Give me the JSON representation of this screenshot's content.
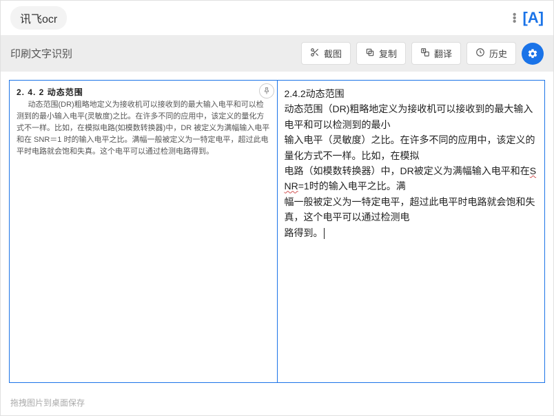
{
  "header": {
    "app_title": "讯飞ocr",
    "logo_text": "[A]"
  },
  "toolbar": {
    "page_title": "印刷文字识别",
    "screenshot_label": "截图",
    "copy_label": "复制",
    "translate_label": "翻译",
    "history_label": "历史"
  },
  "source": {
    "heading": "2. 4. 2  动态范围",
    "body": "动态范围(DR)粗略地定义为接收机可以接收到的最大输入电平和可以检测到的最小输入电平(灵敏度)之比。在许多不同的应用中，该定义的量化方式不一样。比如，在模拟电路(如模数转换器)中，DR 被定义为满幅输入电平和在 SNR＝1 时的输入电平之比。满幅一般被定义为一特定电平，超过此电平时电路就会饱和失真。这个电平可以通过检测电路得到。"
  },
  "result": {
    "line1": "2.4.2动态范围",
    "line2": "动态范围（DR)粗略地定义为接收机可以接收到的最大输入电平和可以检测到的最小",
    "line3": "输入电平（灵敏度）之比。在许多不同的应用中，该定义的量化方式不一样。比如，在模拟",
    "line4a": "电路（如模数转换器）中，DR被定义为满幅输入电平和在",
    "line4b_snr": "SNR",
    "line4c": "=1时的输入电平之比。满",
    "line5": "幅一般被定义为一特定电平，超过此电平时电路就会饱和失真，这个电平可以通过检测电",
    "line6": "路得到。"
  },
  "footer": {
    "hint": "拖拽图片到桌面保存"
  }
}
